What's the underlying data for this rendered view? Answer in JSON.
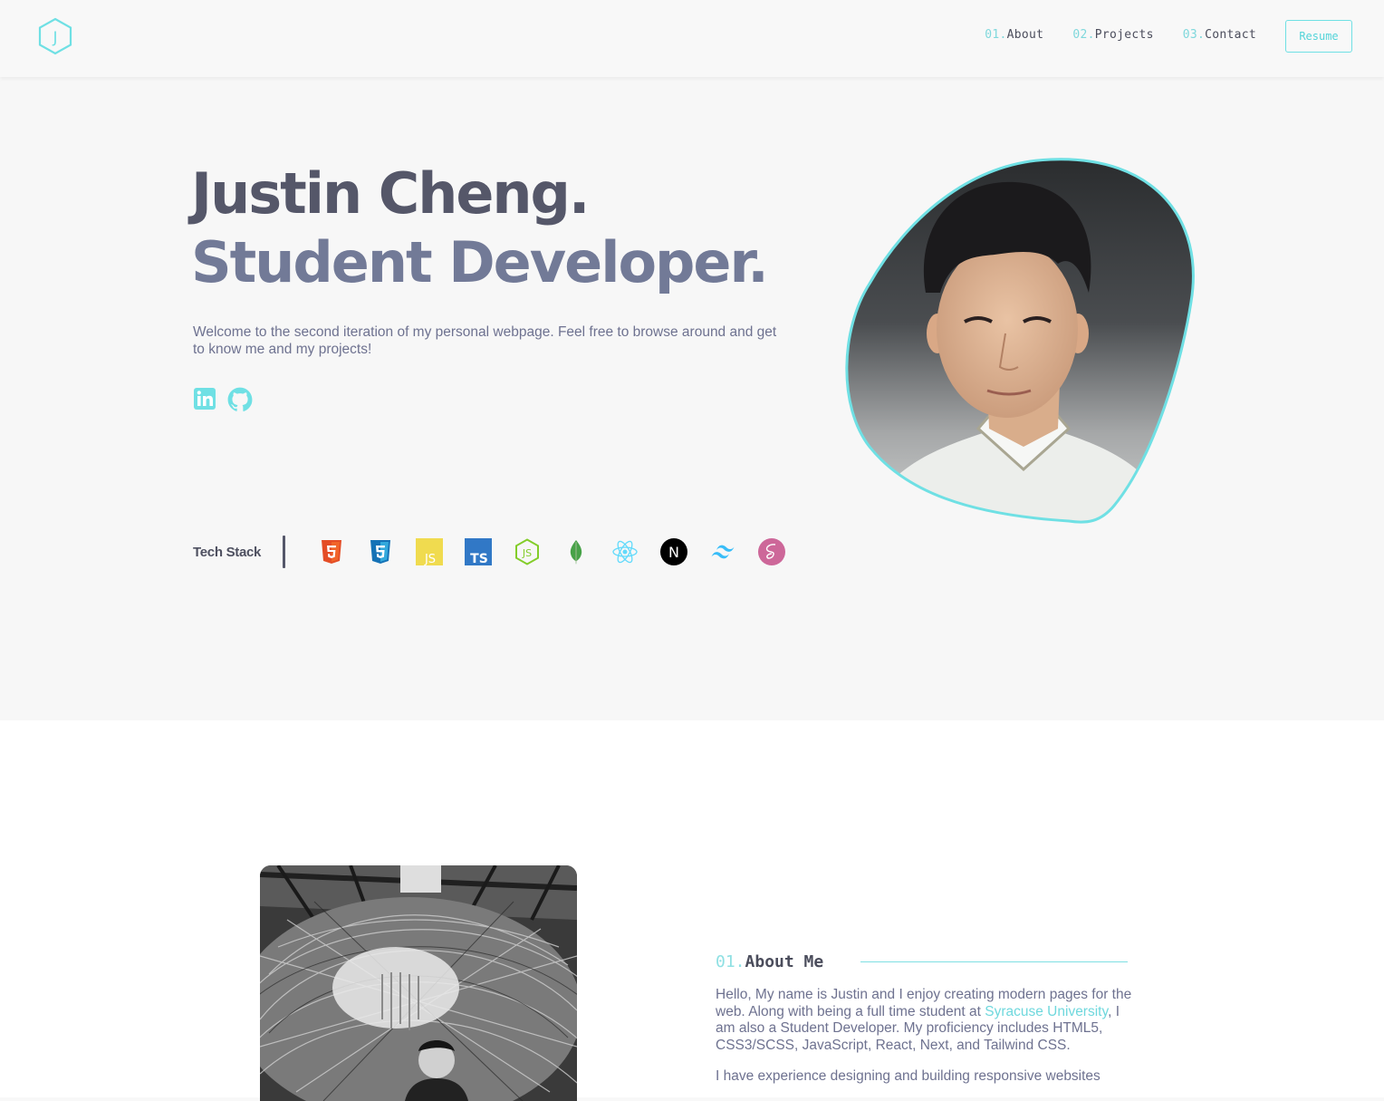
{
  "nav": {
    "logo_icon": "hexagon-j-logo",
    "logo_letter": "J",
    "links": [
      {
        "num": "01.",
        "label": "About"
      },
      {
        "num": "02.",
        "label": "Projects"
      },
      {
        "num": "03.",
        "label": "Contact"
      }
    ],
    "resume_label": "Resume"
  },
  "hero": {
    "name": "Justin Cheng.",
    "title": "Student Developer.",
    "intro": "Welcome to the second iteration of my personal webpage. Feel free to browse around and get to know me and my projects!",
    "socials": [
      "linkedin-icon",
      "github-icon"
    ],
    "tech_stack_label": "Tech Stack",
    "tech_icons": [
      "html5-icon",
      "css3-icon",
      "javascript-icon",
      "typescript-icon",
      "nodejs-icon",
      "mongodb-icon",
      "react-icon",
      "nextjs-icon",
      "tailwindcss-icon",
      "sass-icon"
    ]
  },
  "about": {
    "num": "01.",
    "heading": "About Me",
    "p1_before": "Hello, My name is Justin and I enjoy creating modern pages for the web. Along with being a full time student at ",
    "p1_link": "Syracuse University",
    "p1_after": ", I am also a Student Developer. My proficiency includes HTML5, CSS3/SCSS, JavaScript, React, Next, and Tailwind CSS.",
    "p2": "I have experience designing and building responsive websites"
  },
  "colors": {
    "accent": "#64ffda",
    "accent_cyan": "#6fe0e4",
    "heading_dark": "#555769",
    "heading_light": "#727a97",
    "body_text": "#6e7290",
    "background": "#f7f7f7"
  }
}
